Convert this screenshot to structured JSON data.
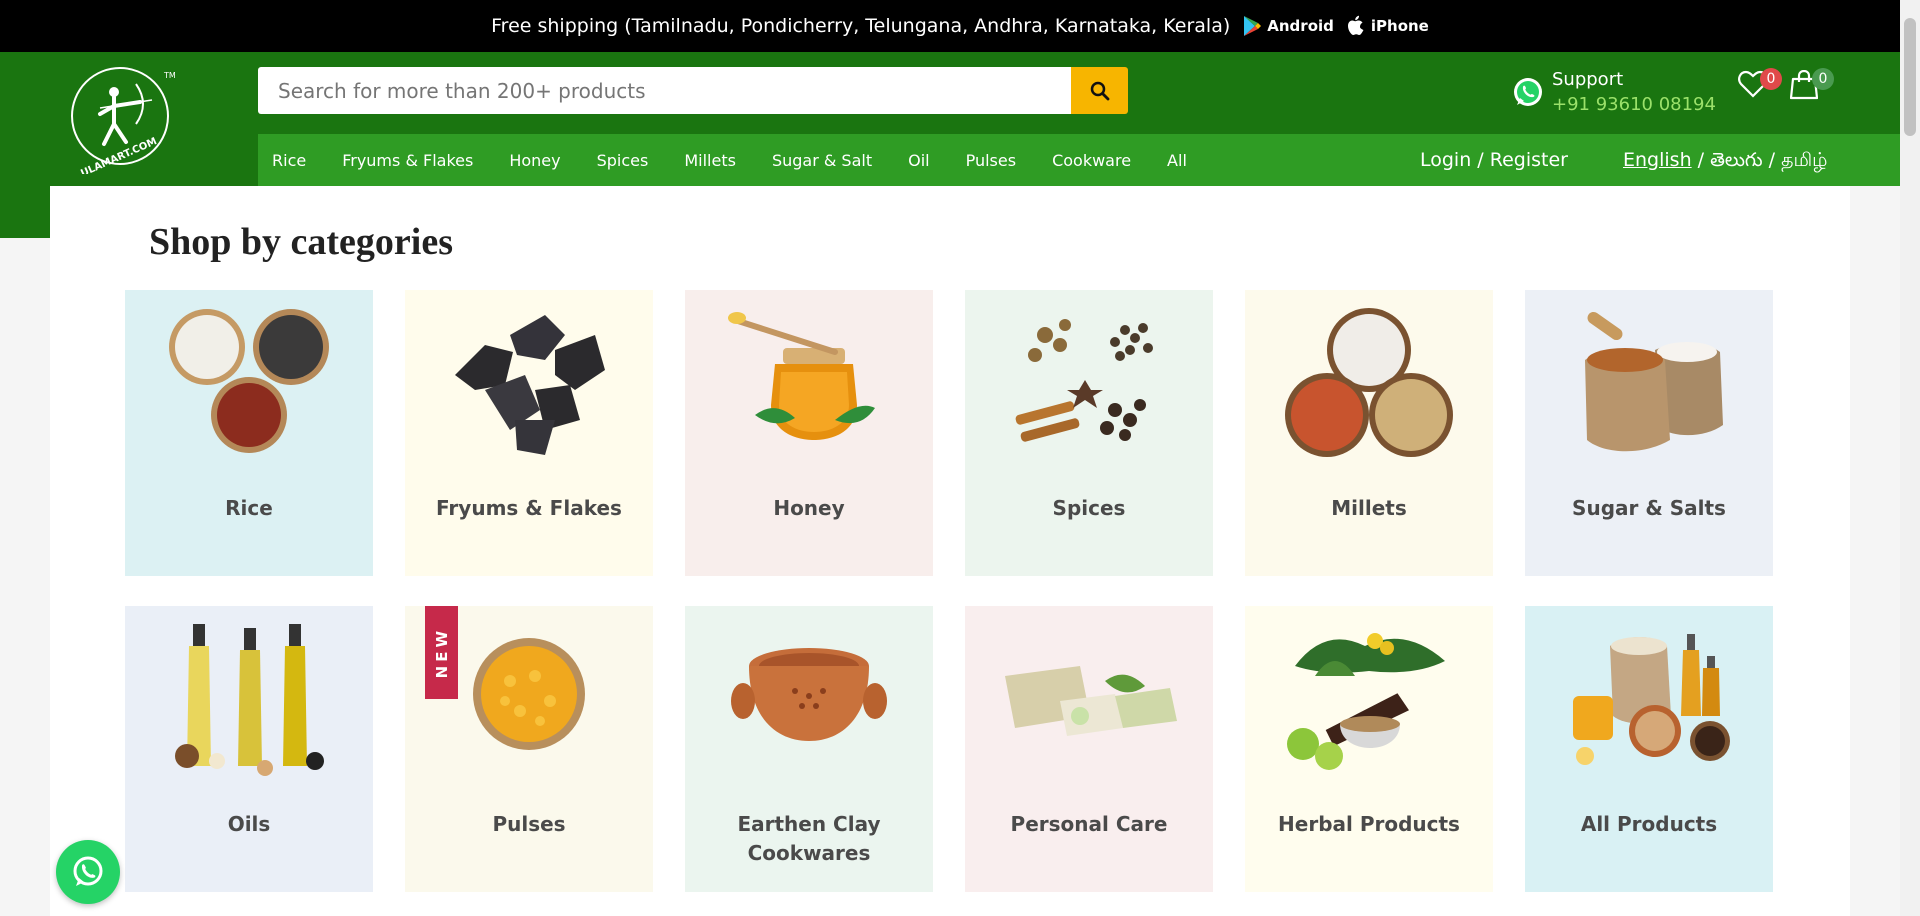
{
  "topbar": {
    "message": "Free shipping (Tamilnadu, Pondicherry, Telungana, Andhra, Karnataka, Kerala)",
    "android_label": "Android",
    "iphone_label": "iPhone"
  },
  "header": {
    "logo_text": "ULAMART.COM",
    "logo_tm": "TM",
    "search": {
      "placeholder": "Search for more than 200+ products",
      "value": ""
    },
    "support": {
      "label": "Support",
      "phone": "+91 93610 08194"
    },
    "wishlist_count": "0",
    "cart_count": "0",
    "login_label": "Login / Register",
    "languages": {
      "english": "English",
      "telugu": "తెలుగు",
      "tamil": "தமிழ்",
      "sep": "/"
    }
  },
  "nav": {
    "items": [
      {
        "label": "Rice"
      },
      {
        "label": "Fryums & Flakes"
      },
      {
        "label": "Honey"
      },
      {
        "label": "Spices"
      },
      {
        "label": "Millets"
      },
      {
        "label": "Sugar & Salt"
      },
      {
        "label": "Oil"
      },
      {
        "label": "Pulses"
      },
      {
        "label": "Cookware"
      },
      {
        "label": "All"
      }
    ]
  },
  "main": {
    "heading": "Shop by categories",
    "new_tag": "NEW",
    "categories": [
      {
        "label": "Rice",
        "bg": "#dcf1f3",
        "icon": "rice-bowls-icon"
      },
      {
        "label": "Fryums & Flakes",
        "bg": "#fffcec",
        "icon": "fryums-icon"
      },
      {
        "label": "Honey",
        "bg": "#f8eeec",
        "icon": "honey-jar-icon"
      },
      {
        "label": "Spices",
        "bg": "#ecf5ee",
        "icon": "spices-icon"
      },
      {
        "label": "Millets",
        "bg": "#fdfaec",
        "icon": "millet-bowls-icon"
      },
      {
        "label": "Sugar & Salts",
        "bg": "#ecf0f6",
        "icon": "sugar-salt-sack-icon"
      },
      {
        "label": "Oils",
        "bg": "#eaeff7",
        "icon": "oil-bottles-icon"
      },
      {
        "label": "Pulses",
        "bg": "#fbf9ec",
        "icon": "pulses-bowl-icon"
      },
      {
        "label": "Earthen Clay Cookwares",
        "bg": "#ebf5ef",
        "icon": "clay-pot-icon"
      },
      {
        "label": "Personal Care",
        "bg": "#f9eeee",
        "icon": "soap-icon"
      },
      {
        "label": "Herbal Products",
        "bg": "#fffdee",
        "icon": "herbs-icon"
      },
      {
        "label": "All Products",
        "bg": "#d9f1f4",
        "icon": "all-products-icon"
      }
    ]
  },
  "colors": {
    "topbar": "#000000",
    "header": "#1a7510",
    "nav": "#2f9c24",
    "search_button": "#f7b500",
    "phone_text": "#9be16a",
    "new_tag": "#c6294a",
    "whatsapp": "#25d366"
  }
}
